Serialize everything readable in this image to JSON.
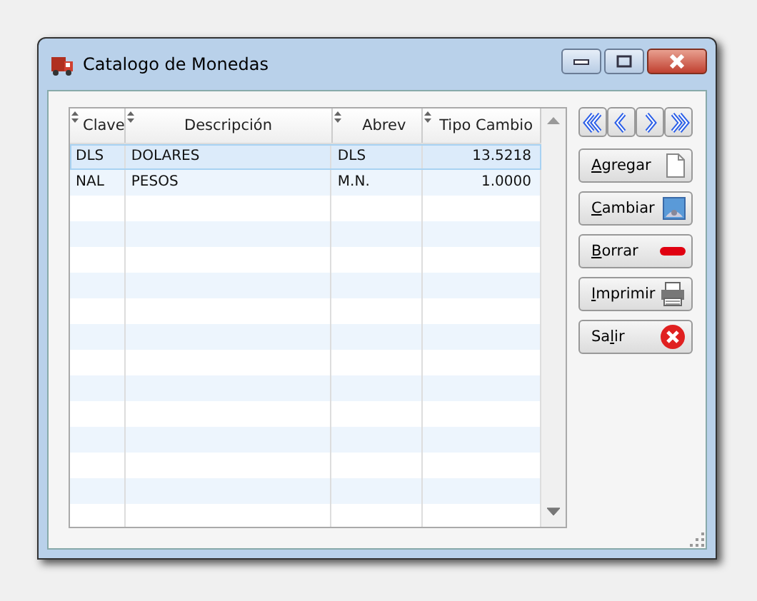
{
  "window": {
    "title": "Catalogo de Monedas"
  },
  "table": {
    "columns": [
      "Clave",
      "Descripción",
      "Abrev",
      "Tipo Cambio"
    ],
    "rows": [
      {
        "cells": [
          "DLS",
          "DOLARES",
          "DLS",
          "13.5218"
        ],
        "selected": true
      },
      {
        "cells": [
          "NAL",
          "PESOS",
          "M.N.",
          "1.0000"
        ],
        "selected": false
      }
    ]
  },
  "navigation": [
    {
      "kind": "first"
    },
    {
      "kind": "prev"
    },
    {
      "kind": "next"
    },
    {
      "kind": "last"
    }
  ],
  "buttons": [
    {
      "label": [
        {
          "text": "A",
          "underlined": true
        },
        {
          "text": "gregar",
          "underlined": false
        }
      ],
      "kind": "new"
    },
    {
      "label": [
        {
          "text": "C",
          "underlined": true
        },
        {
          "text": "ambiar",
          "underlined": false
        }
      ],
      "kind": "edit"
    },
    {
      "label": [
        {
          "text": "B",
          "underlined": true
        },
        {
          "text": "orrar",
          "underlined": false
        }
      ],
      "kind": "delete"
    },
    {
      "label": [
        {
          "text": "I",
          "underlined": true
        },
        {
          "text": "mprimir",
          "underlined": false
        }
      ],
      "kind": "print"
    },
    {
      "label": [
        {
          "text": "Sa",
          "underlined": false
        },
        {
          "text": "l",
          "underlined": true
        },
        {
          "text": "ir",
          "underlined": false
        }
      ],
      "kind": "exit"
    }
  ]
}
